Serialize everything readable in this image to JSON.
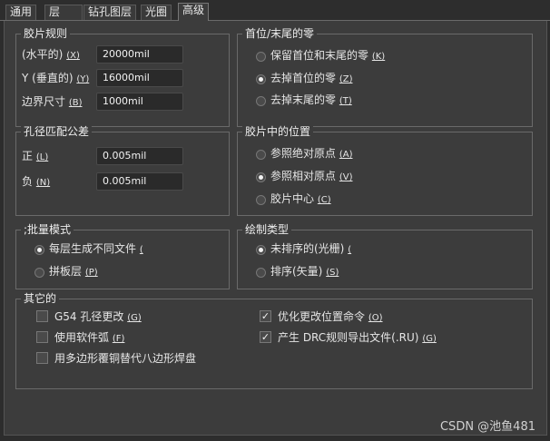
{
  "tabs": [
    {
      "label": "通用"
    },
    {
      "label": "层"
    },
    {
      "label": "钻孔图层"
    },
    {
      "label": "光圈"
    },
    {
      "label": "高级"
    }
  ],
  "film_rules": {
    "title": "胶片规则",
    "h_label": "(水平的)",
    "h_key": "(X)",
    "h_value": "20000mil",
    "v_label": "Y (垂直的)",
    "v_key": "(Y)",
    "v_value": "16000mil",
    "b_label": "边界尺寸",
    "b_key": "(B)",
    "b_value": "1000mil"
  },
  "zeros": {
    "title": "首位/末尾的零",
    "opt1": "保留首位和末尾的零",
    "opt1_key": "(K)",
    "opt2": "去掉首位的零",
    "opt2_key": "(Z)",
    "opt3": "去掉末尾的零",
    "opt3_key": "(T)",
    "selected": 2
  },
  "hole_tol": {
    "title": "孔径匹配公差",
    "pos_label": "正",
    "pos_key": "(L)",
    "pos_value": "0.005mil",
    "neg_label": "负",
    "neg_key": "(N)",
    "neg_value": "0.005mil"
  },
  "film_pos": {
    "title": "胶片中的位置",
    "opt1": "参照绝对原点",
    "opt1_key": "(A)",
    "opt2": "参照相对原点",
    "opt2_key": "(V)",
    "opt3": "胶片中心",
    "opt3_key": "(C)",
    "selected": 2
  },
  "batch": {
    "title": ";批量模式",
    "opt1": "每层生成不同文件",
    "opt1_key": "(",
    "opt2": "拼板层",
    "opt2_key": "(P)",
    "selected": 1
  },
  "plot": {
    "title": "绘制类型",
    "opt1": "未排序的(光栅)",
    "opt1_key": "(",
    "opt2": "排序(矢量)",
    "opt2_key": "(S)",
    "selected": 1
  },
  "other": {
    "title": "其它的",
    "c1": "G54 孔径更改",
    "c1_key": "(G)",
    "c1_checked": false,
    "c2": "使用软件弧",
    "c2_key": "(F)",
    "c2_checked": false,
    "c3": "用多边形覆铜替代八边形焊盘",
    "c3_checked": false,
    "c4": "优化更改位置命令",
    "c4_key": "(O)",
    "c4_checked": true,
    "c5": "产生 DRC规则导出文件(.RU)",
    "c5_key": "(G)",
    "c5_checked": true
  },
  "watermark": "CSDN @池鱼481",
  "colors": {
    "background": "#3c3c3c",
    "text": "#e6e6e6",
    "border": "#6a6a6a"
  }
}
